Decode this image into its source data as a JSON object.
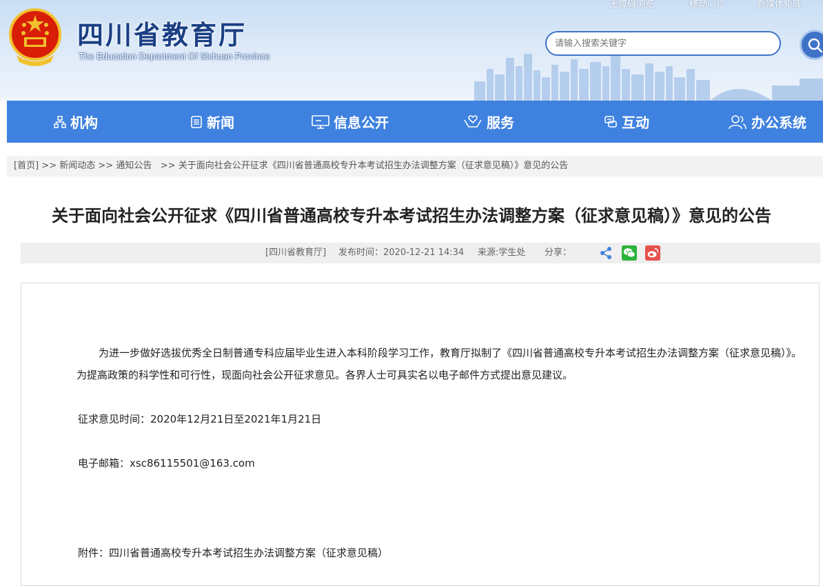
{
  "header": {
    "title": "四川省教育厅",
    "subtitle": "The Education Department Of Sichuan Province",
    "top_links": [
      "无障碍浏览",
      "移动门户",
      "新媒体矩阵"
    ],
    "search_placeholder": "请输入搜索关键字",
    "emblem": "national-emblem",
    "search_icon": "search-icon"
  },
  "nav": {
    "items": [
      {
        "label": "机构",
        "icon": "org-chart-icon"
      },
      {
        "label": "新闻",
        "icon": "news-icon"
      },
      {
        "label": "信息公开",
        "icon": "monitor-icon"
      },
      {
        "label": "服务",
        "icon": "hands-icon"
      },
      {
        "label": "互动",
        "icon": "chat-icon"
      },
      {
        "label": "办公系统",
        "icon": "users-icon"
      }
    ],
    "color": "#3e81df"
  },
  "breadcrumb": {
    "home": "[首页]",
    "items": [
      "新闻动态",
      "通知公告",
      "关于面向社会公开征求《四川省普通高校专升本考试招生办法调整方案（征求意见稿）》意见的公告"
    ],
    "separator": ">>"
  },
  "article": {
    "title": "关于面向社会公开征求《四川省普通高校专升本考试招生办法调整方案（征求意见稿）》意见的公告",
    "source_org": "[四川省教育厅]",
    "publish_time": "发布时间：2020-12-21 14:34",
    "source": "来源:学生处",
    "share_label": "分享：",
    "share_icons": [
      "share-icon",
      "wechat-icon",
      "weibo-icon"
    ],
    "paragraph": "为进一步做好选拔优秀全日制普通专科应届毕业生进入本科阶段学习工作，教育厅拟制了《四川省普通高校专升本考试招生办法调整方案（征求意见稿）》。为提高政策的科学性和可行性，现面向社会公开征求意见。各界人士可具实名以电子邮件方式提出意见建议。",
    "period": "征求意见时间：2020年12月21日至2021年1月21日",
    "email": "电子邮箱：xsc86115501@163.com",
    "attachment": "附件：四川省普通高校专升本考试招生办法调整方案（征求意见稿）"
  }
}
